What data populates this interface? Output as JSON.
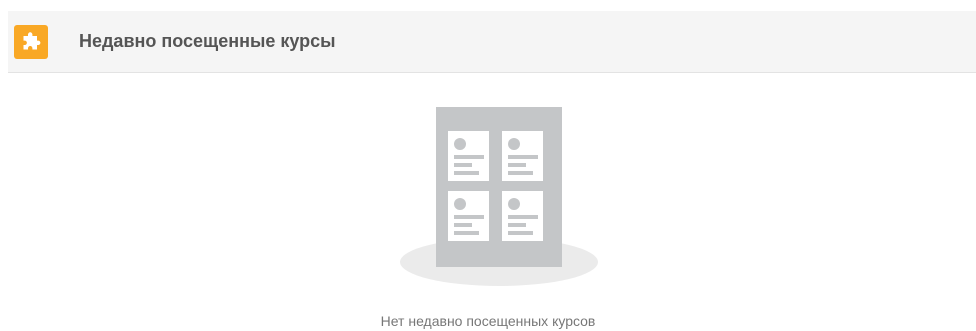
{
  "header": {
    "title": "Недавно посещенные курсы",
    "icon": "puzzle-piece-icon",
    "accent_color": "#f9a825"
  },
  "empty_state": {
    "message": "Нет недавно посещенных курсов",
    "illustration": "course-cards-placeholder-icon"
  }
}
